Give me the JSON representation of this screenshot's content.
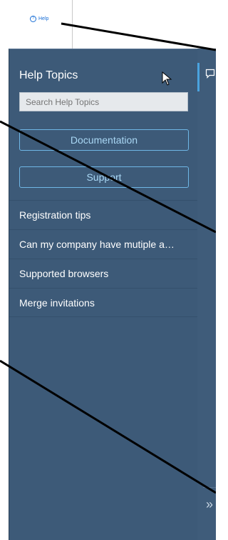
{
  "help_link": {
    "label": "Help"
  },
  "panel": {
    "title": "Help Topics",
    "search_placeholder": "Search Help Topics",
    "buttons": {
      "documentation": "Documentation",
      "support": "Support"
    },
    "topics": [
      "Registration tips",
      "Can my company have mutiple a…",
      "Supported browsers",
      "Merge invitations"
    ]
  },
  "rail": {
    "expand_glyph": "»"
  },
  "colors": {
    "panel_bg": "#3d5a78",
    "accent": "#4aa3df",
    "link": "#1a6fd6"
  }
}
